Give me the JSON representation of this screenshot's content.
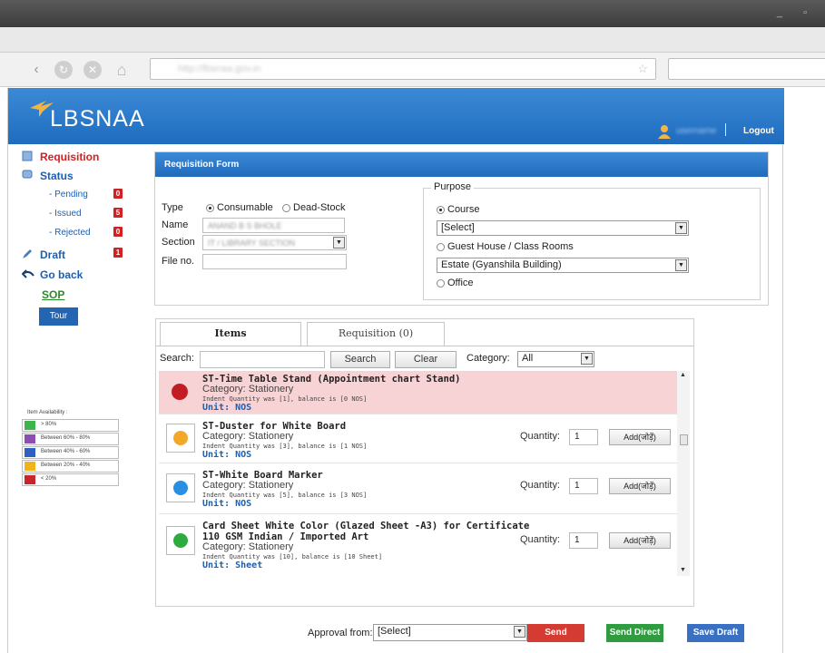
{
  "window": {
    "controls": "_ ▫"
  },
  "browser": {
    "url": "http://lbsnaa.gov.in",
    "url_star": "☆",
    "nav": {
      "back": "‹",
      "refresh": "↻",
      "stop": "✕",
      "home": "⌂"
    }
  },
  "header": {
    "logo_text": "LBSNAA",
    "user_name": "username",
    "logout": "Logout"
  },
  "sidebar": {
    "requisition": "Requisition",
    "status": "Status",
    "pending": "- Pending",
    "pending_count": "0",
    "issued": "- Issued",
    "issued_count": "5",
    "rejected": "- Rejected",
    "rejected_count": "0",
    "draft": "Draft",
    "draft_count": "1",
    "go_back": "Go back",
    "sop": "SOP",
    "tour": "Tour"
  },
  "legend": {
    "title": "Item Availability :",
    "rows": [
      {
        "label": "> 80%",
        "color": "#3db54a"
      },
      {
        "label": "Between 60% - 80%",
        "color": "#8a4fb0"
      },
      {
        "label": "Between 40% - 60%",
        "color": "#2f5fbf"
      },
      {
        "label": "Between 20% - 40%",
        "color": "#f0b31a"
      },
      {
        "label": "< 20%",
        "color": "#c9252c"
      }
    ]
  },
  "form": {
    "title": "Requisition Form",
    "type_label": "Type",
    "type_consumable": "Consumable",
    "type_deadstock": "Dead-Stock",
    "name_label": "Name",
    "name_value": "ANAND B S BHOLE",
    "section_label": "Section",
    "section_value": "IT / LIBRARY SECTION",
    "fileno_label": "File no.",
    "purpose": {
      "title": "Purpose",
      "course": "Course",
      "course_select": "[Select]",
      "guest": "Guest House / Class Rooms",
      "estate_select": "Estate (Gyanshila Building)",
      "office": "Office"
    }
  },
  "items_panel": {
    "tab_items": "Items",
    "tab_requisition": "Requisition (0)",
    "search_label": "Search:",
    "search_button": "Search",
    "clear_button": "Clear",
    "category_label": "Category:",
    "category_value": "All",
    "qty_label": "Quantity:",
    "add_label": "Add(जोड़ें)",
    "items": [
      {
        "name": "ST-Time Table Stand (Appointment chart Stand)",
        "category": "Category: Stationery",
        "indent": "Indent Quantity was [1], balance is [0 NOS]",
        "unit": "Unit: NOS",
        "color": "#c21d23",
        "qty": ""
      },
      {
        "name": "ST-Duster for White Board",
        "category": "Category: Stationery",
        "indent": "Indent Quantity was [3], balance is [1 NOS]",
        "unit": "Unit: NOS",
        "color": "#f3a82a",
        "qty": "1"
      },
      {
        "name": "ST-White Board Marker",
        "category": "Category: Stationery",
        "indent": "Indent Quantity was [5], balance is [3 NOS]",
        "unit": "Unit: NOS",
        "color": "#2a8fe0",
        "qty": "1"
      },
      {
        "name": "Card Sheet White Color (Glazed Sheet -A3) for Certificate",
        "name2": "110 GSM Indian / Imported Art",
        "category": "Category: Stationery",
        "indent": "Indent Quantity was [10], balance is [10 Sheet]",
        "unit": "Unit: Sheet",
        "color": "#2eab3e",
        "qty": "1"
      }
    ]
  },
  "footer": {
    "approval_label": "Approval from:",
    "approval_value": "[Select]",
    "send": "Send",
    "send_color": "#d33b33",
    "send_direct": "Send Direct",
    "send_direct_color": "#2e9c3f",
    "save_draft": "Save Draft",
    "save_draft_color": "#3a70c2"
  }
}
